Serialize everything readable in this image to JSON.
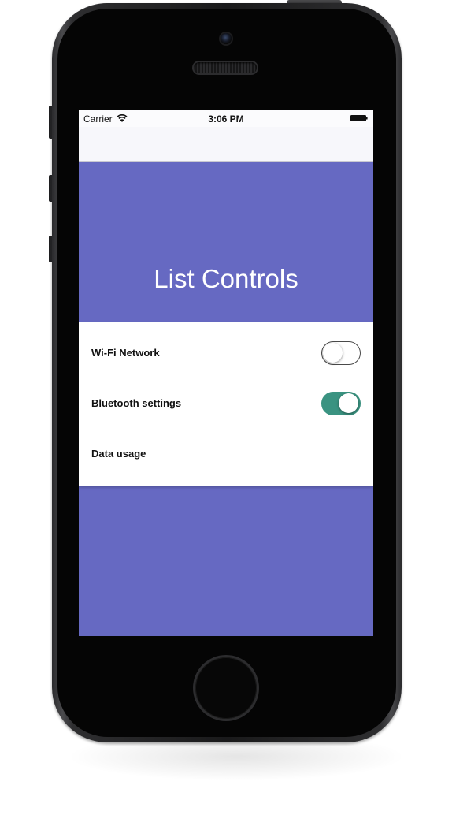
{
  "status_bar": {
    "carrier": "Carrier",
    "time": "3:06 PM"
  },
  "hero": {
    "title": "List Controls"
  },
  "list": {
    "items": [
      {
        "label": "Wi-Fi Network",
        "toggle": "off"
      },
      {
        "label": "Bluetooth settings",
        "toggle": "on"
      },
      {
        "label": "Data usage"
      }
    ]
  },
  "colors": {
    "primary": "#6669c2",
    "toggle_on": "#3a9381",
    "phone_body": "#1a1a1b"
  },
  "icons": [
    "wifi-icon",
    "battery-icon"
  ]
}
